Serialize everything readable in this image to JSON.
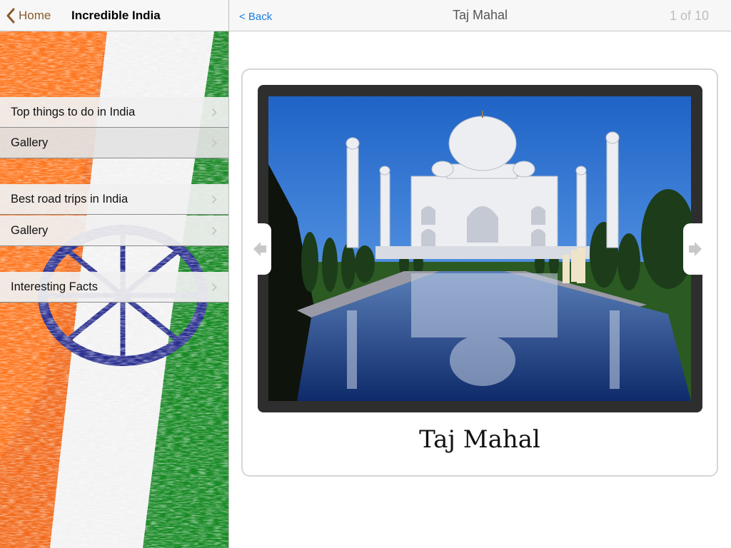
{
  "master": {
    "back_label": "Home",
    "title": "Incredible India",
    "items": [
      {
        "label": "Top things to do in India"
      },
      {
        "label": "Gallery"
      },
      {
        "label": "Best road trips in India"
      },
      {
        "label": "Gallery"
      },
      {
        "label": "Interesting Facts"
      }
    ]
  },
  "detail": {
    "back_label": "< Back",
    "title": "Taj Mahal",
    "page_count": "1 of 10",
    "caption": "Taj Mahal",
    "prev_icon": "left-arrow-icon",
    "next_icon": "right-arrow-icon"
  },
  "colors": {
    "home_accent": "#8a5a2b",
    "back_accent": "#1a7ee0",
    "flag_saffron": "#f26b1d",
    "flag_green": "#1e8a2a",
    "chakra_blue": "#2a2f8f"
  }
}
